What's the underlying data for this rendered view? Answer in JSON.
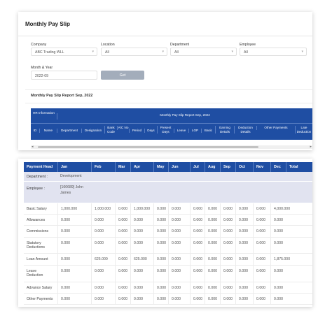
{
  "page": {
    "title": "Monthly Pay Slip"
  },
  "filters": {
    "company": {
      "label": "Company",
      "value": "ABC Trading WLL"
    },
    "location": {
      "label": "Location",
      "value": "All"
    },
    "department": {
      "label": "Department",
      "value": "All"
    },
    "employee": {
      "label": "Employee",
      "value": "All"
    },
    "month_year": {
      "label": "Month & Year",
      "value": "2022-09"
    },
    "get_label": "Get"
  },
  "report": {
    "title": "Monthly Pay Slip Report Sep, 2022",
    "group_hr": "HR Information",
    "group_report": "Monthly Pay Slip Report Sep, 2022",
    "columns": [
      "ID",
      "Name",
      "Department",
      "Designation",
      "Bank Code",
      "A/C No",
      "Period",
      "Days",
      "Present Days",
      "Leave",
      "LOP",
      "Basic",
      "Earning Details",
      "Deduction Details",
      "Other Payments",
      "Late Deduction"
    ]
  },
  "breakdown": {
    "headers": [
      "Payment Head",
      "Jan",
      "Feb",
      "Mar",
      "Apr",
      "May",
      "Jun",
      "Jul",
      "Aug",
      "Sep",
      "Oct",
      "Nov",
      "Dec",
      "Total"
    ],
    "department_label": "Department :",
    "department_value": "Development",
    "employee_label": "Employee :",
    "employee_value_line1": "[160689] John",
    "employee_value_line2": "James",
    "rows": [
      {
        "line1": "Basic Salary",
        "line2": "",
        "values": [
          "1,000.000",
          "1,000.000",
          "0.000",
          "1,000.000",
          "0.000",
          "0.000",
          "0.000",
          "0.000",
          "0.000",
          "0.000",
          "0.000",
          "4,000.000"
        ]
      },
      {
        "line1": "Allowances",
        "line2": "",
        "values": [
          "0.000",
          "0.000",
          "0.000",
          "0.000",
          "0.000",
          "0.000",
          "0.000",
          "0.000",
          "0.000",
          "0.000",
          "0.000",
          "0.000"
        ]
      },
      {
        "line1": "Commissions",
        "line2": "",
        "values": [
          "0.000",
          "0.000",
          "0.000",
          "0.000",
          "0.000",
          "0.000",
          "0.000",
          "0.000",
          "0.000",
          "0.000",
          "0.000",
          "0.000"
        ]
      },
      {
        "line1": "Statutory",
        "line2": "Deductions",
        "values": [
          "0.000",
          "0.000",
          "0.000",
          "0.000",
          "0.000",
          "0.000",
          "0.000",
          "0.000",
          "0.000",
          "0.000",
          "0.000",
          "0.000"
        ]
      },
      {
        "line1": "Loan Amount",
        "line2": "",
        "values": [
          "0.000",
          "625.000",
          "0.000",
          "625.000",
          "0.000",
          "0.000",
          "0.000",
          "0.000",
          "0.000",
          "0.000",
          "0.000",
          "1,875.000"
        ]
      },
      {
        "line1": "Leave",
        "line2": "Deduction",
        "values": [
          "0.000",
          "0.000",
          "0.000",
          "0.000",
          "0.000",
          "0.000",
          "0.000",
          "0.000",
          "0.000",
          "0.000",
          "0.000",
          "0.000"
        ]
      },
      {
        "line1": "Advance Salary",
        "line2": "",
        "values": [
          "0.000",
          "0.000",
          "0.000",
          "0.000",
          "0.000",
          "0.000",
          "0.000",
          "0.000",
          "0.000",
          "0.000",
          "0.000",
          "0.000"
        ]
      },
      {
        "line1": "Other Payments",
        "line2": "",
        "values": [
          "0.000",
          "0.000",
          "0.000",
          "0.000",
          "0.000",
          "0.000",
          "0.000",
          "0.000",
          "0.000",
          "0.000",
          "0.000",
          "0.000"
        ]
      }
    ]
  },
  "colors": {
    "header_blue": "#1f4ea3",
    "group_row": "#e1e3f0",
    "button": "#a3adbb"
  }
}
